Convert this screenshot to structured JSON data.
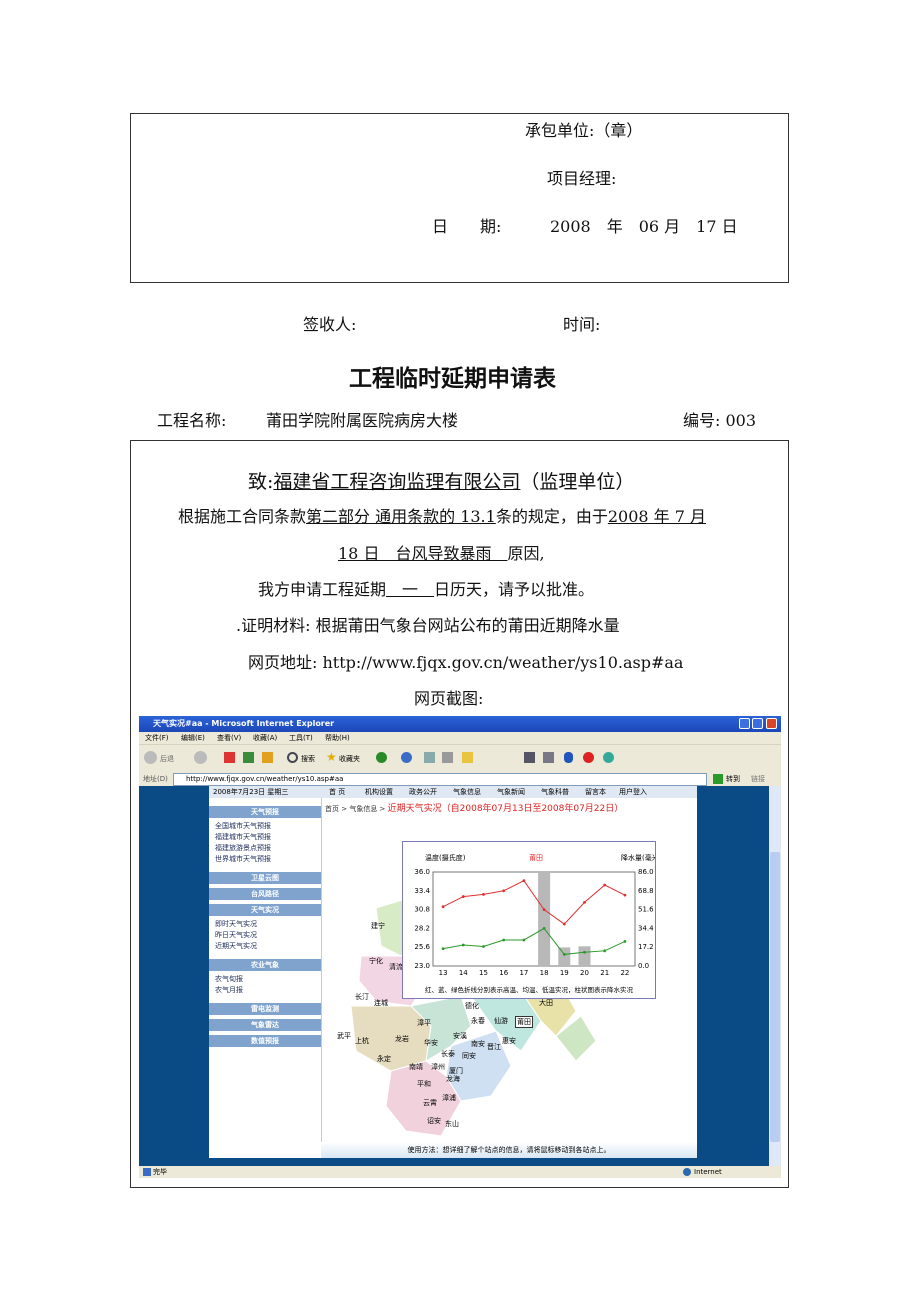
{
  "top_box": {
    "contractor": "承包单位:（章）",
    "manager": "项目经理:",
    "date_label": "日　　期:",
    "date_value": "2008　年　06 月　17 日"
  },
  "signer": "签收人:",
  "time_label": "时间:",
  "form_title": "工程临时延期申请表",
  "project_label": "工程名称:",
  "project_name": "莆田学院附属医院病房大楼",
  "number": "编号: 003",
  "body": {
    "to_prefix": "致:",
    "to_org": "福建省工程咨询监理有限公司",
    "to_suffix": "（监理单位）",
    "l1_a": "根据施工合同条款",
    "l1_b": "第二部分 通用条款的 13.1",
    "l1_c": "条的规定，由于",
    "l1_d": "2008 年 7 月",
    "l2_a": "18 日　台风导致暴雨　",
    "l2_b": "原因,",
    "l3_a": "我方申请工程延期",
    "l3_b": "　一　",
    "l3_c": "日历天，请予以批准。",
    "l4": ".证明材料: 根据莆田气象台网站公布的莆田近期降水量",
    "l5": "网页地址: http://www.fjqx.gov.cn/weather/ys10.asp#aa",
    "l6": "网页截图:"
  },
  "screenshot": {
    "window_title": "天气实况#aa - Microsoft Internet Explorer",
    "menu": [
      "文件(F)",
      "编辑(E)",
      "查看(V)",
      "收藏(A)",
      "工具(T)",
      "帮助(H)"
    ],
    "toolbar": {
      "back": "后退",
      "search": "搜索",
      "favorites": "收藏夹"
    },
    "address_label": "地址(D)",
    "address": "http://www.fjqx.gov.cn/weather/ys10.asp#aa",
    "go": "转到",
    "links": "链接",
    "status_left": "完毕",
    "status_right": "Internet",
    "date_bar": "2008年7月23日 星期三",
    "nav": [
      "首 页",
      "机构设置",
      "政务公开",
      "气象信息",
      "气象新闻",
      "气象科普",
      "留言本",
      "用户登入"
    ],
    "breadcrumb": "首页 > 气象信息 >",
    "breadcrumb_red": "近期天气实况（自2008年07月13日至2008年07月22日）",
    "side": {
      "h1": "天气预报",
      "items1": [
        "全国城市天气预报",
        "福建城市天气预报",
        "福建旅游景点预报",
        "世界城市天气预报"
      ],
      "h2": "卫星云图",
      "h3": "台风路径",
      "h4": "天气实况",
      "items2": [
        "即时天气实况",
        "昨日天气实况",
        "近期天气实况"
      ],
      "h5": "农业气象",
      "items3": [
        "农气旬报",
        "农气月报"
      ],
      "h6": "雷电监测",
      "h7": "气象雷达",
      "h8": "数值预报"
    },
    "map_labels": [
      "建宁",
      "宁化",
      "清流",
      "长汀",
      "连城",
      "武平",
      "上杭",
      "龙岩",
      "永定",
      "漳平",
      "华安",
      "长泰",
      "南靖",
      "漳州",
      "平和",
      "龙海",
      "厦门",
      "同安",
      "安溪",
      "南安",
      "晋江",
      "惠安",
      "永春",
      "德化",
      "仙游",
      "莆田",
      "云霄",
      "漳浦",
      "诏安",
      "东山",
      "大田",
      "泉州",
      "福清"
    ],
    "usage": "使用方法：想详细了解个站点的信息，请将鼠标移动到各站点上。"
  },
  "chart_data": {
    "type": "line",
    "title": "莆田",
    "ylabel_left": "温度(摄氏度)",
    "ylabel_right": "降水量(毫米)",
    "x": [
      13,
      14,
      15,
      16,
      17,
      18,
      19,
      20,
      21,
      22
    ],
    "ylim_left": [
      23.0,
      36.0
    ],
    "ylim_right": [
      0.0,
      86.0
    ],
    "yticks_left": [
      "36.0",
      "33.4",
      "30.8",
      "28.2",
      "25.6",
      "23.0"
    ],
    "yticks_right": [
      "86.0",
      "68.8",
      "51.6",
      "34.4",
      "17.2",
      "0.0"
    ],
    "series": [
      {
        "name": "高温",
        "color": "#e03030",
        "values": [
          31.2,
          32.6,
          32.9,
          33.4,
          34.8,
          30.8,
          28.8,
          31.8,
          34.2,
          32.8
        ]
      },
      {
        "name": "低温",
        "color": "#2a9a2a",
        "values": [
          25.4,
          25.9,
          25.7,
          26.6,
          26.6,
          28.2,
          24.6,
          24.9,
          25.1,
          26.4
        ]
      },
      {
        "name": "降水量",
        "color": "#b8b8b8",
        "type": "bar",
        "values": [
          0,
          0,
          0,
          0,
          0,
          86,
          17,
          18,
          0,
          0
        ]
      }
    ],
    "caption": "红、蓝、绿色折线分别表示高温、均温、低温实况，柱状图表示降水实况"
  }
}
